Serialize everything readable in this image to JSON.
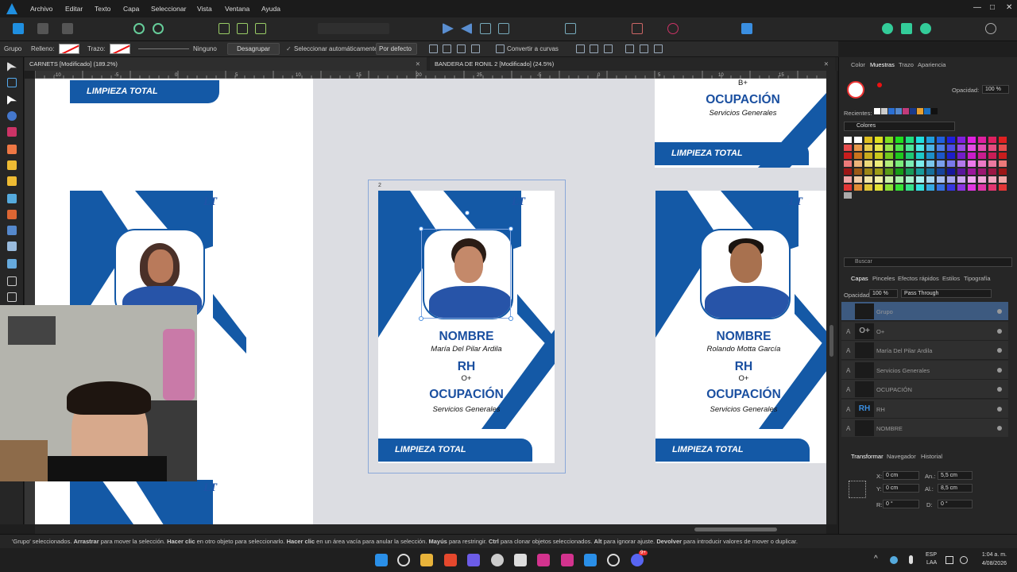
{
  "menubar": {
    "items": [
      "Archivo",
      "Editar",
      "Texto",
      "Capa",
      "Seleccionar",
      "Vista",
      "Ventana",
      "Ayuda"
    ],
    "window_controls": [
      "—",
      "□",
      "✕"
    ]
  },
  "context": {
    "group": "Grupo",
    "fill": "Relleno:",
    "stroke": "Trazo:",
    "none": "Ninguno",
    "ungroup": "Desagrupar",
    "auto_select": "Seleccionar automáticamente:",
    "default": "Por defecto",
    "convert": "Convertir a curvas"
  },
  "tabs": [
    {
      "label": "CARNETS [Modificado] (189.2%)"
    },
    {
      "label": "BANDERA DE RONIL 2 [Modificado] (24.5%)"
    }
  ],
  "ruler": {
    "top": [
      "-10",
      "-5",
      "0",
      "5",
      "10",
      "15",
      "20",
      "25",
      "-5",
      "0",
      "5",
      "10",
      "15"
    ]
  },
  "canvas": {
    "artboard_label": "2",
    "logo": "LT",
    "banner": "LIMPIEZA TOTAL",
    "cards": [
      {
        "name_title": "NOMBRE",
        "name": "María Del Pilar Ardila",
        "rh_title": "RH",
        "rh": "O+",
        "occ_title": "OCUPACIÓN",
        "occ": "Servicios Generales"
      },
      {
        "name_title": "NOMBRE",
        "name": "Rolando Motta García",
        "rh_title": "RH",
        "rh": "O+",
        "occ_title": "OCUPACIÓN",
        "occ": "Servicios Generales"
      }
    ],
    "top_right": {
      "rh": "B+",
      "occ_title": "OCUPACIÓN",
      "occ": "Servicios Generales"
    }
  },
  "panel": {
    "tabs": [
      "Color",
      "Muestras",
      "Trazo",
      "Apariencia"
    ],
    "opacity_label": "Opacidad:",
    "opacity": "100 %",
    "recent": "Recientes:",
    "palette": "Colores",
    "search_placeholder": "Buscar",
    "layer_tabs": [
      "Capas",
      "Pinceles",
      "Efectos rápidos",
      "Estilos",
      "Tipografía"
    ],
    "layer_opacity": "100 %",
    "blend": "Pass Through",
    "layers": [
      {
        "a": "",
        "thumb": "",
        "name": "Grupo"
      },
      {
        "a": "A",
        "thumb": "O+",
        "name": "O+"
      },
      {
        "a": "A",
        "thumb": "",
        "name": "María Del Pilar Ardila"
      },
      {
        "a": "A",
        "thumb": "",
        "name": "Servicios Generales"
      },
      {
        "a": "A",
        "thumb": "",
        "name": "OCUPACIÓN"
      },
      {
        "a": "A",
        "thumb": "RH",
        "name": "RH"
      },
      {
        "a": "A",
        "thumb": "",
        "name": "NOMBRE"
      }
    ],
    "transform_tabs": [
      "Transformar",
      "Navegador",
      "Historial"
    ],
    "transform": {
      "x_label": "X:",
      "x": "0 cm",
      "y_label": "Y:",
      "y": "0 cm",
      "w_label": "An.:",
      "w": "5,5 cm",
      "h_label": "Al.:",
      "h": "8,5 cm",
      "r_label": "R:",
      "r": "0 °",
      "s_label": "D:",
      "s": "0 °"
    }
  },
  "status": {
    "prefix": "'Grupo' seleccionados.",
    "b1": "Arrastrar",
    "t1": " para mover la selección. ",
    "b2": "Hacer clic",
    "t2": " en otro objeto para seleccionarlo. ",
    "b3": "Hacer clic",
    "t3": " en un área vacía para anular la selección. ",
    "b4": "Mayús",
    "t4": " para restringir. ",
    "b5": "Ctrl",
    "t5": " para clonar objetos seleccionados. ",
    "b6": "Alt",
    "t6": " para ignorar ajuste. ",
    "b7": "Devolver",
    "t7": " para introducir valores de mover o duplicar."
  },
  "taskbar": {
    "lang": "ESP",
    "lang2": "LAA",
    "time": "1:04 a. m.",
    "date": "4/08/2026",
    "badge": "9+"
  },
  "colors": {
    "accent": "#1459a6"
  }
}
